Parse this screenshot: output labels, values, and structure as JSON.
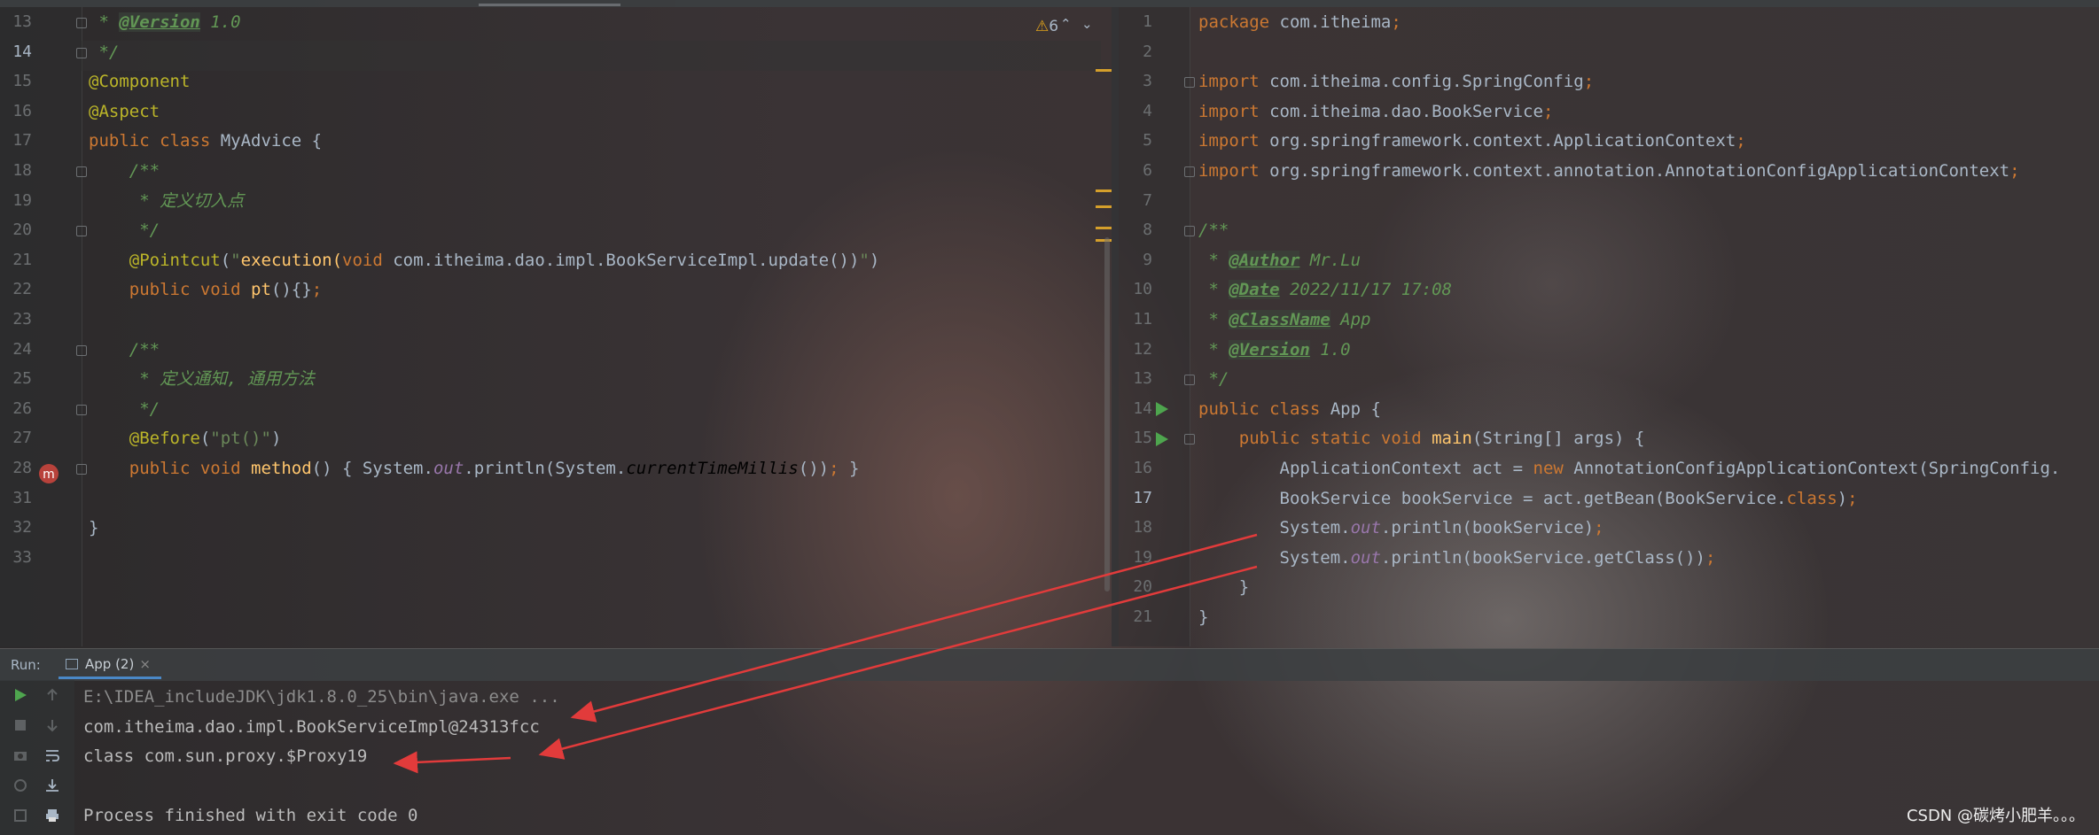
{
  "left_editor": {
    "warning_count": "6",
    "nav_up": "⌃",
    "nav_down": "⌄",
    "lines": [
      {
        "n": "13",
        "segments": [
          {
            "t": " * ",
            "c": "cm"
          },
          {
            "t": "@Version",
            "c": "tag"
          },
          {
            "t": " 1.0",
            "c": "cm"
          }
        ]
      },
      {
        "n": "14",
        "segments": [
          {
            "t": " */",
            "c": "cm"
          }
        ]
      },
      {
        "n": "15",
        "segments": [
          {
            "t": "@Component",
            "c": "an"
          }
        ]
      },
      {
        "n": "16",
        "segments": [
          {
            "t": "@Aspect",
            "c": "an"
          }
        ]
      },
      {
        "n": "17",
        "segments": [
          {
            "t": "public class ",
            "c": "kw"
          },
          {
            "t": "MyAdvice {",
            "c": "pl"
          }
        ]
      },
      {
        "n": "18",
        "segments": [
          {
            "t": "    /**",
            "c": "cm"
          }
        ]
      },
      {
        "n": "19",
        "segments": [
          {
            "t": "     * 定义切入点",
            "c": "cm"
          }
        ]
      },
      {
        "n": "20",
        "segments": [
          {
            "t": "     */",
            "c": "cm"
          }
        ]
      },
      {
        "n": "21",
        "segments": [
          {
            "t": "    @Pointcut",
            "c": "an"
          },
          {
            "t": "(",
            "c": "pl"
          },
          {
            "t": "\"",
            "c": "str"
          },
          {
            "t": "execution(",
            "c": "fn"
          },
          {
            "t": "void ",
            "c": "kw"
          },
          {
            "t": "com.itheima.dao.impl.BookServiceImpl.update())",
            "c": "pl"
          },
          {
            "t": "\"",
            "c": "str"
          },
          {
            "t": ")",
            "c": "pl"
          }
        ]
      },
      {
        "n": "22",
        "segments": [
          {
            "t": "    public void ",
            "c": "kw"
          },
          {
            "t": "pt",
            "c": "fn"
          },
          {
            "t": "(){}",
            "c": "pl"
          },
          {
            "t": ";",
            "c": "kw"
          }
        ]
      },
      {
        "n": "23",
        "segments": []
      },
      {
        "n": "24",
        "segments": [
          {
            "t": "    /**",
            "c": "cm"
          }
        ]
      },
      {
        "n": "25",
        "segments": [
          {
            "t": "     * 定义通知, 通用方法",
            "c": "cm"
          }
        ]
      },
      {
        "n": "26",
        "segments": [
          {
            "t": "     */",
            "c": "cm"
          }
        ]
      },
      {
        "n": "27",
        "segments": [
          {
            "t": "    @Before",
            "c": "an"
          },
          {
            "t": "(",
            "c": "pl"
          },
          {
            "t": "\"pt()\"",
            "c": "str"
          },
          {
            "t": ")",
            "c": "pl"
          }
        ]
      },
      {
        "n": "28",
        "segments": [
          {
            "t": "    public void ",
            "c": "kw"
          },
          {
            "t": "method",
            "c": "fn"
          },
          {
            "t": "() { System.",
            "c": "pl"
          },
          {
            "t": "out",
            "c": "fld"
          },
          {
            "t": ".println(System.",
            "c": "pl"
          },
          {
            "t": "currentTimeMillis",
            "c": "st"
          },
          {
            "t": "())",
            "c": "pl"
          },
          {
            "t": ";",
            "c": "kw"
          },
          {
            "t": " }",
            "c": "pl"
          }
        ]
      },
      {
        "n": "31",
        "segments": []
      },
      {
        "n": "32",
        "segments": [
          {
            "t": "}",
            "c": "pl"
          }
        ]
      },
      {
        "n": "33",
        "segments": []
      }
    ]
  },
  "right_editor": {
    "lines": [
      {
        "n": "1",
        "segments": [
          {
            "t": "package ",
            "c": "kw"
          },
          {
            "t": "com.itheima",
            "c": "pl"
          },
          {
            "t": ";",
            "c": "kw"
          }
        ]
      },
      {
        "n": "2",
        "segments": []
      },
      {
        "n": "3",
        "segments": [
          {
            "t": "import ",
            "c": "kw"
          },
          {
            "t": "com.itheima.config.SpringConfig",
            "c": "pl"
          },
          {
            "t": ";",
            "c": "kw"
          }
        ]
      },
      {
        "n": "4",
        "segments": [
          {
            "t": "import ",
            "c": "kw"
          },
          {
            "t": "com.itheima.dao.BookService",
            "c": "pl"
          },
          {
            "t": ";",
            "c": "kw"
          }
        ]
      },
      {
        "n": "5",
        "segments": [
          {
            "t": "import ",
            "c": "kw"
          },
          {
            "t": "org.springframework.context.ApplicationContext",
            "c": "pl"
          },
          {
            "t": ";",
            "c": "kw"
          }
        ]
      },
      {
        "n": "6",
        "segments": [
          {
            "t": "import ",
            "c": "kw"
          },
          {
            "t": "org.springframework.context.annotation.AnnotationConfigApplicationContext",
            "c": "pl"
          },
          {
            "t": ";",
            "c": "kw"
          }
        ]
      },
      {
        "n": "7",
        "segments": []
      },
      {
        "n": "8",
        "segments": [
          {
            "t": "/**",
            "c": "cm"
          }
        ]
      },
      {
        "n": "9",
        "segments": [
          {
            "t": " * ",
            "c": "cm"
          },
          {
            "t": "@Author",
            "c": "tag"
          },
          {
            "t": " Mr.Lu",
            "c": "cm"
          }
        ]
      },
      {
        "n": "10",
        "segments": [
          {
            "t": " * ",
            "c": "cm"
          },
          {
            "t": "@Date",
            "c": "tag"
          },
          {
            "t": " 2022/11/17 17:08",
            "c": "cm"
          }
        ]
      },
      {
        "n": "11",
        "segments": [
          {
            "t": " * ",
            "c": "cm"
          },
          {
            "t": "@ClassName",
            "c": "tag"
          },
          {
            "t": " App",
            "c": "cm"
          }
        ]
      },
      {
        "n": "12",
        "segments": [
          {
            "t": " * ",
            "c": "cm"
          },
          {
            "t": "@Version",
            "c": "tag"
          },
          {
            "t": " 1.0",
            "c": "cm"
          }
        ]
      },
      {
        "n": "13",
        "segments": [
          {
            "t": " */",
            "c": "cm"
          }
        ]
      },
      {
        "n": "14",
        "segments": [
          {
            "t": "public class ",
            "c": "kw"
          },
          {
            "t": "App {",
            "c": "pl"
          }
        ]
      },
      {
        "n": "15",
        "segments": [
          {
            "t": "    public static void ",
            "c": "kw"
          },
          {
            "t": "main",
            "c": "fn"
          },
          {
            "t": "(String[] args) {",
            "c": "pl"
          }
        ]
      },
      {
        "n": "16",
        "segments": [
          {
            "t": "        ApplicationContext act = ",
            "c": "pl"
          },
          {
            "t": "new ",
            "c": "kw"
          },
          {
            "t": "AnnotationConfigApplicationContext(SpringConfig.",
            "c": "pl"
          }
        ]
      },
      {
        "n": "17",
        "segments": [
          {
            "t": "        BookService bookService = act.getBean(BookService.",
            "c": "pl"
          },
          {
            "t": "class",
            "c": "kw"
          },
          {
            "t": ")",
            "c": "pl"
          },
          {
            "t": ";",
            "c": "kw"
          }
        ]
      },
      {
        "n": "18",
        "segments": [
          {
            "t": "        System.",
            "c": "pl"
          },
          {
            "t": "out",
            "c": "fld"
          },
          {
            "t": ".println(bookService)",
            "c": "pl"
          },
          {
            "t": ";",
            "c": "kw"
          }
        ]
      },
      {
        "n": "19",
        "segments": [
          {
            "t": "        System.",
            "c": "pl"
          },
          {
            "t": "out",
            "c": "fld"
          },
          {
            "t": ".println(bookService.getClass())",
            "c": "pl"
          },
          {
            "t": ";",
            "c": "kw"
          }
        ]
      },
      {
        "n": "20",
        "segments": [
          {
            "t": "    }",
            "c": "pl"
          }
        ]
      },
      {
        "n": "21",
        "segments": [
          {
            "t": "}",
            "c": "pl"
          }
        ]
      }
    ]
  },
  "run_panel": {
    "label": "Run:",
    "tab_label": "App (2)",
    "tab_close": "×",
    "output": [
      "E:\\IDEA_includeJDK\\jdk1.8.0_25\\bin\\java.exe ...",
      "com.itheima.dao.impl.BookServiceImpl@24313fcc",
      "class com.sun.proxy.$Proxy19",
      "",
      "Process finished with exit code 0"
    ]
  },
  "watermark": "CSDN @碳烤小肥羊。。。",
  "colors": {
    "keyword": "#cc7832",
    "annotation": "#bbb529",
    "string": "#6a8759",
    "comment": "#629755",
    "method": "#ffc66d",
    "field": "#9876aa",
    "plain": "#a9b7c6",
    "arrow": "#e23b3b",
    "run_icon": "#4ea54e"
  },
  "icons": [
    "warning-icon",
    "run-gutter-icon",
    "override-gutter-icon",
    "run-play-icon",
    "stop-icon",
    "scroll-up-icon",
    "scroll-down-icon",
    "soft-wrap-icon",
    "scroll-to-end-icon",
    "print-icon"
  ]
}
